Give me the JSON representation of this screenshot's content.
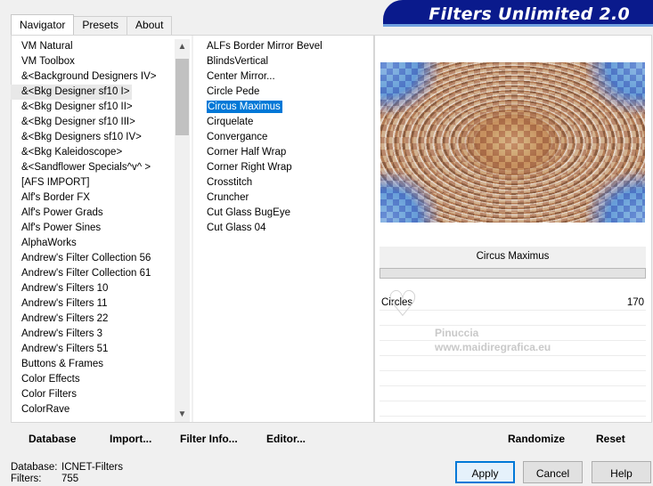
{
  "app": {
    "title": "Filters Unlimited 2.0"
  },
  "tabs": [
    {
      "label": "Navigator",
      "active": true
    },
    {
      "label": "Presets",
      "active": false
    },
    {
      "label": "About",
      "active": false
    }
  ],
  "categories": {
    "items": [
      "VM Natural",
      "VM Toolbox",
      "&<Background Designers IV>",
      "&<Bkg Designer sf10 I>",
      "&<Bkg Designer sf10 II>",
      "&<Bkg Designer sf10 III>",
      "&<Bkg Designers sf10 IV>",
      "&<Bkg Kaleidoscope>",
      "&<Sandflower Specials^v^ >",
      "[AFS IMPORT]",
      "Alf's Border FX",
      "Alf's Power Grads",
      "Alf's Power Sines",
      "AlphaWorks",
      "Andrew's Filter Collection 56",
      "Andrew's Filter Collection 61",
      "Andrew's Filters 10",
      "Andrew's Filters 11",
      "Andrew's Filters 22",
      "Andrew's Filters 3",
      "Andrew's Filters 51",
      "Buttons & Frames",
      "Color Effects",
      "Color Filters",
      "ColorRave"
    ],
    "selected_index": 3
  },
  "filters": {
    "items": [
      "ALFs Border Mirror Bevel",
      "BlindsVertical",
      "Center Mirror...",
      "Circle Pede",
      "Circus Maximus",
      "Cirquelate",
      "Convergance",
      "Corner Half Wrap",
      "Corner Right Wrap",
      "Crosstitch",
      "Cruncher",
      "Cut Glass  BugEye",
      "Cut Glass 04"
    ],
    "selected_index": 4
  },
  "preview": {
    "filter_name": "Circus Maximus"
  },
  "params": [
    {
      "label": "Circles",
      "value": "170"
    }
  ],
  "watermark": {
    "line1": "Pinuccia",
    "line2": "www.maidiregrafica.eu"
  },
  "bottom_left": {
    "database": "Database",
    "import": "Import...",
    "filter_info": "Filter Info...",
    "editor": "Editor..."
  },
  "bottom_right": {
    "randomize": "Randomize",
    "reset": "Reset"
  },
  "status": {
    "database_label": "Database:",
    "database_value": "ICNET-Filters",
    "filters_label": "Filters:",
    "filters_value": "755"
  },
  "buttons": {
    "apply": "Apply",
    "cancel": "Cancel",
    "help": "Help"
  },
  "colors": {
    "selection": "#0078d7",
    "banner": "#0a1a8c"
  }
}
